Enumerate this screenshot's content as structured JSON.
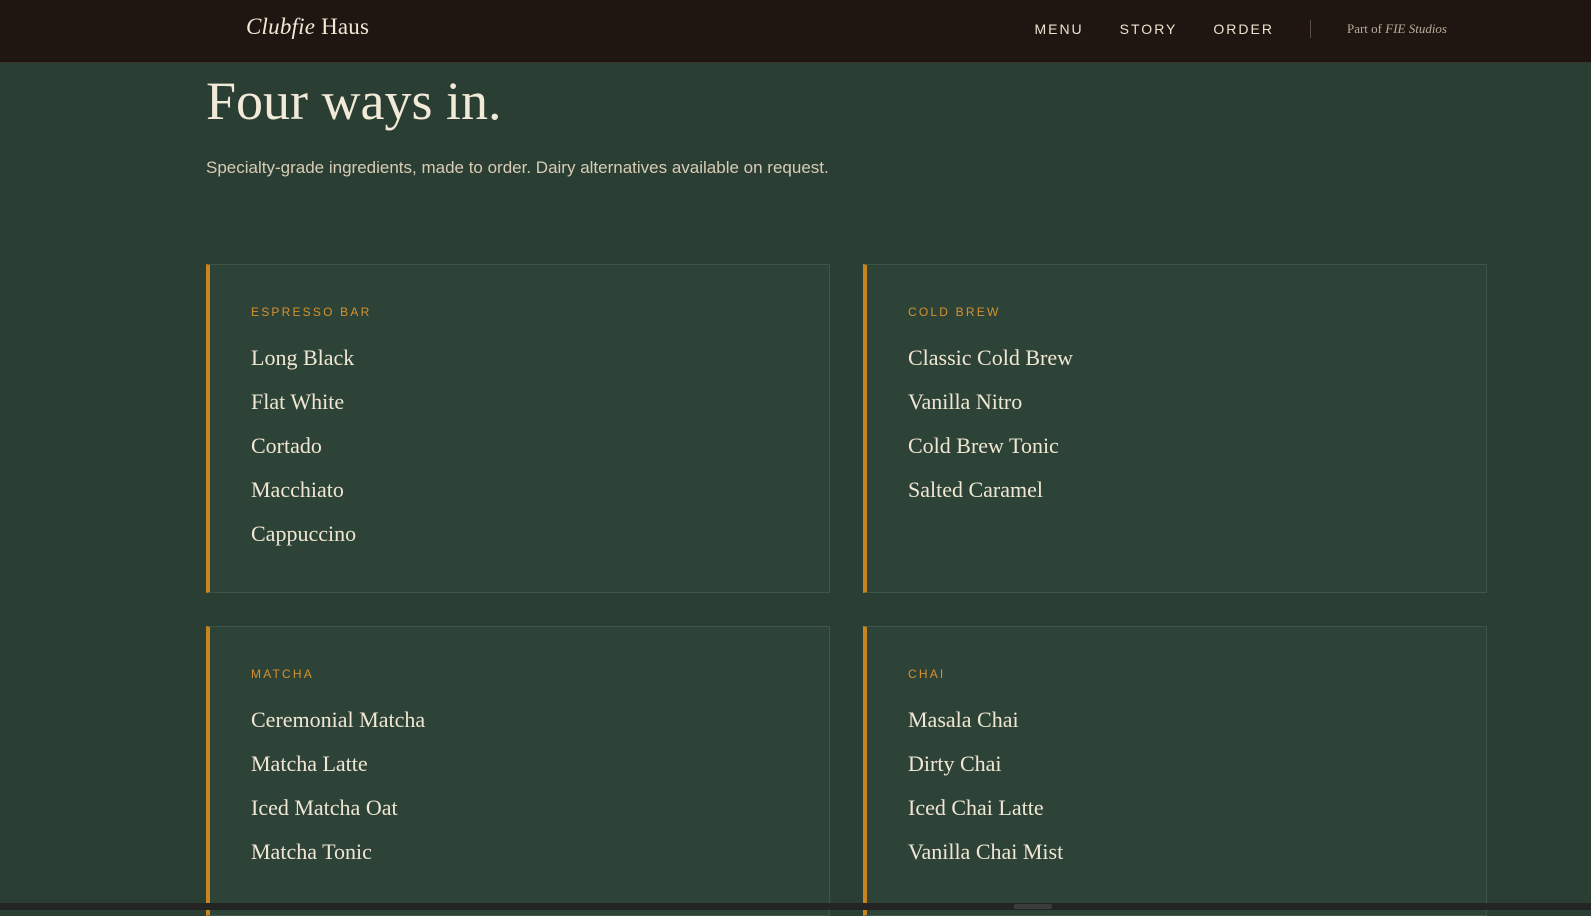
{
  "header": {
    "brand_italic": "Clubfie",
    "brand_rest": " Haus",
    "nav": [
      {
        "label": "MENU"
      },
      {
        "label": "STORY"
      },
      {
        "label": "ORDER"
      }
    ],
    "studio_prefix": "Part of ",
    "studio_name": "FIE Studios"
  },
  "hero": {
    "title": "Four ways in.",
    "subtitle": "Specialty-grade ingredients, made to order. Dairy alternatives available on request."
  },
  "cards": [
    {
      "label": "ESPRESSO BAR",
      "items": [
        "Long Black",
        "Flat White",
        "Cortado",
        "Macchiato",
        "Cappuccino"
      ]
    },
    {
      "label": "COLD BREW",
      "items": [
        "Classic Cold Brew",
        "Vanilla Nitro",
        "Cold Brew Tonic",
        "Salted Caramel"
      ]
    },
    {
      "label": "MATCHA",
      "items": [
        "Ceremonial Matcha",
        "Matcha Latte",
        "Iced Matcha Oat",
        "Matcha Tonic"
      ]
    },
    {
      "label": "CHAI",
      "items": [
        "Masala Chai",
        "Dirty Chai",
        "Iced Chai Latte",
        "Vanilla Chai Mist"
      ]
    }
  ],
  "colors": {
    "page_bg": "#2b3e33",
    "header_bg": "#1f1511",
    "accent": "#c8841f",
    "text": "#ece3cf"
  }
}
